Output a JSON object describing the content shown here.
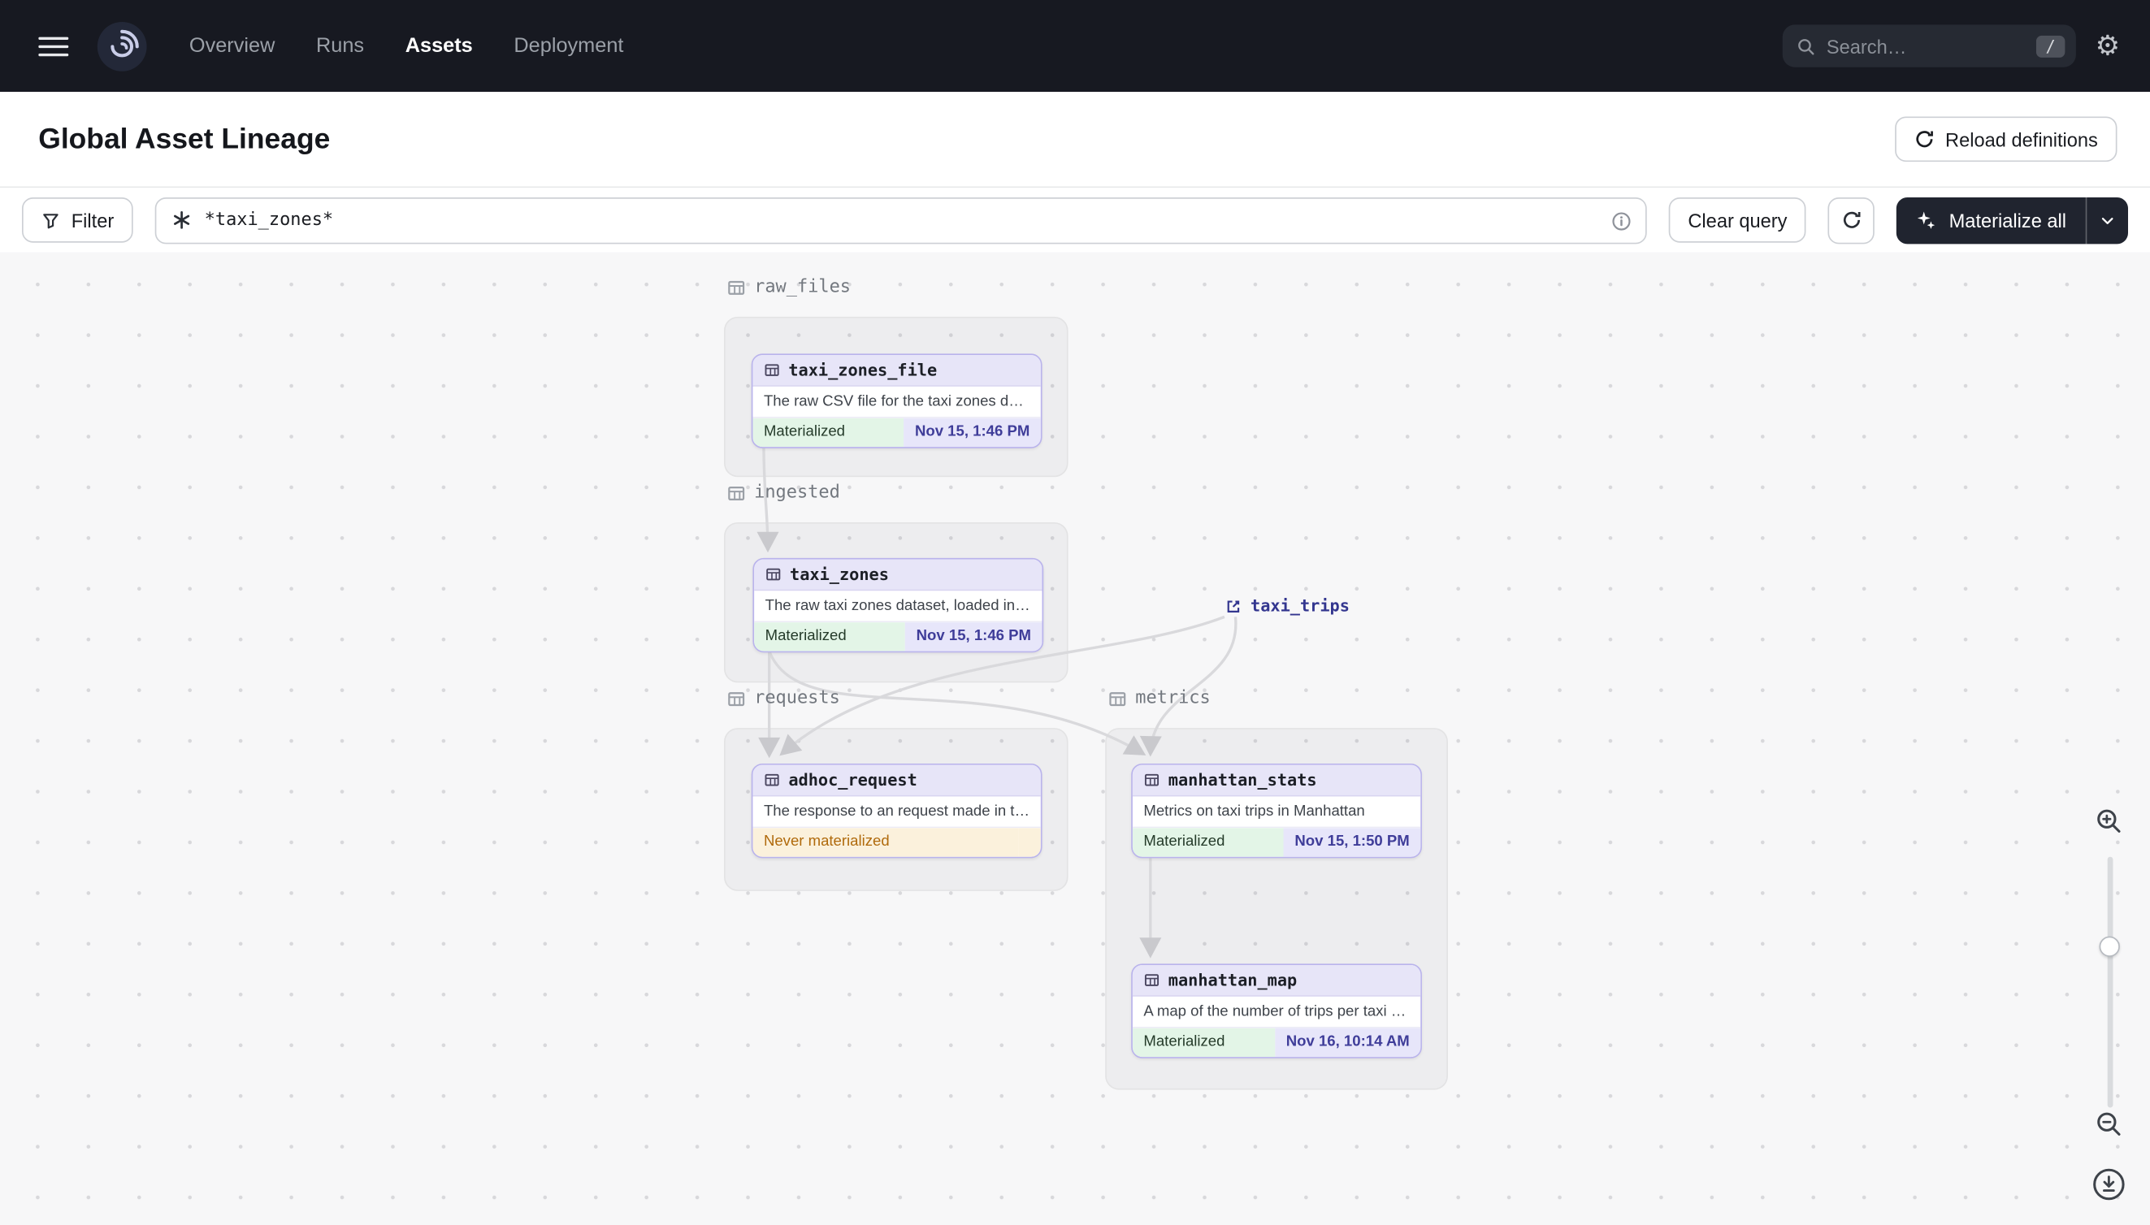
{
  "colors": {
    "nav-bg": "#171921",
    "canvas-bg": "#F7F7F8",
    "node-border": "#B9B3EC",
    "node-header-bg": "#E7E5F8",
    "materialized-bg": "#E3F5E7",
    "timestamp-bg": "#E7E6FA",
    "timestamp-text": "#3F3D99",
    "warning-bg": "#FBF1DC",
    "warning-text": "#B06A0C",
    "primary-dark": "#20242F"
  },
  "nav": {
    "items": [
      {
        "label": "Overview"
      },
      {
        "label": "Runs"
      },
      {
        "label": "Assets"
      },
      {
        "label": "Deployment"
      }
    ],
    "search_placeholder": "Search…",
    "search_shortcut": "/",
    "gear_glyph": "⚙"
  },
  "header": {
    "title": "Global Asset Lineage",
    "reload_button": "Reload definitions"
  },
  "toolbar": {
    "filter_label": "Filter",
    "query_value": "*taxi_zones*",
    "clear_query_label": "Clear query",
    "materialize_label": "Materialize all"
  },
  "graph": {
    "groups": [
      {
        "name": "raw_files"
      },
      {
        "name": "ingested"
      },
      {
        "name": "requests"
      },
      {
        "name": "metrics"
      }
    ],
    "external_assets": [
      {
        "name": "taxi_trips"
      }
    ],
    "nodes": [
      {
        "name": "taxi_zones_file",
        "description": "The raw CSV file for the taxi zones dat...",
        "status": "Materialized",
        "timestamp": "Nov 15, 1:46 PM"
      },
      {
        "name": "taxi_zones",
        "description": "The raw taxi zones dataset, loaded int...",
        "status": "Materialized",
        "timestamp": "Nov 15, 1:46 PM"
      },
      {
        "name": "adhoc_request",
        "description": "The response to an request made in th...",
        "status": "Never materialized",
        "timestamp": ""
      },
      {
        "name": "manhattan_stats",
        "description": "Metrics on taxi trips in Manhattan",
        "status": "Materialized",
        "timestamp": "Nov 15, 1:50 PM"
      },
      {
        "name": "manhattan_map",
        "description": "A map of the number of trips per taxi z...",
        "status": "Materialized",
        "timestamp": "Nov 16, 10:14 AM"
      }
    ]
  }
}
